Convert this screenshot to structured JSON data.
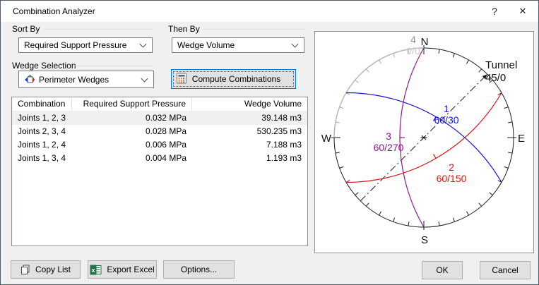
{
  "window": {
    "title": "Combination Analyzer",
    "help_glyph": "?",
    "close_glyph": "✕"
  },
  "sort_by": {
    "label": "Sort By",
    "value": "Required Support Pressure"
  },
  "then_by": {
    "label": "Then By",
    "value": "Wedge Volume"
  },
  "wedge_selection": {
    "label": "Wedge Selection",
    "value": "Perimeter Wedges"
  },
  "compute_button": {
    "label": "Compute Combinations"
  },
  "table": {
    "columns": [
      "Combination",
      "Required Support Pressure",
      "Wedge Volume"
    ],
    "rows": [
      {
        "combination": "Joints 1, 2, 3",
        "pressure": "0.032 MPa",
        "volume": "39.148 m3"
      },
      {
        "combination": "Joints 2, 3, 4",
        "pressure": "0.028 MPa",
        "volume": "530.235 m3"
      },
      {
        "combination": "Joints 1, 2, 4",
        "pressure": "0.006 MPa",
        "volume": "7.188 m3"
      },
      {
        "combination": "Joints 1, 3, 4",
        "pressure": "0.004 MPa",
        "volume": "1.193 m3"
      }
    ]
  },
  "stereonet": {
    "cardinals": {
      "n": "N",
      "e": "E",
      "s": "S",
      "w": "W"
    },
    "tunnel": {
      "name": "Tunnel",
      "orientation": "45/0"
    },
    "joints": [
      {
        "id": "1",
        "orientation": "60/30",
        "color": "#1414d8"
      },
      {
        "id": "2",
        "orientation": "60/150",
        "color": "#e01212"
      },
      {
        "id": "3",
        "orientation": "60/270",
        "color": "#8c1a8c"
      },
      {
        "id": "4",
        "orientation": "0/0",
        "color": "#909090",
        "orientation_color": "#c9c9c9"
      }
    ]
  },
  "footer": {
    "copy_list": "Copy List",
    "export_excel": "Export Excel",
    "options": "Options...",
    "ok": "OK",
    "cancel": "Cancel"
  },
  "colors": {
    "accent": "#0078d7",
    "excel_green": "#217346"
  }
}
